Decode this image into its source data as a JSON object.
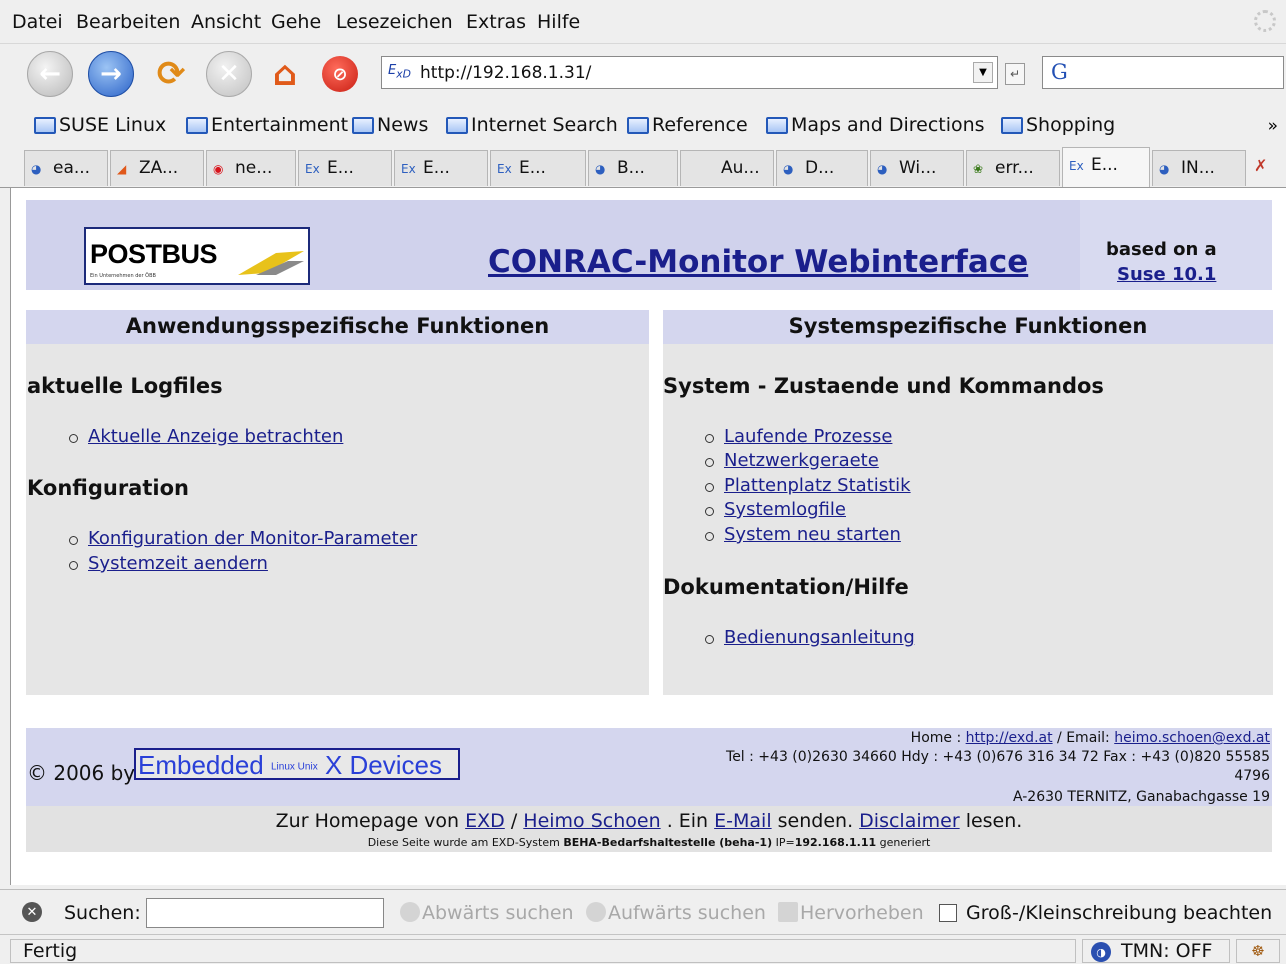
{
  "menu": {
    "items": [
      "Datei",
      "Bearbeiten",
      "Ansicht",
      "Gehe",
      "Lesezeichen",
      "Extras",
      "Hilfe"
    ]
  },
  "navbar": {
    "url": "http://192.168.1.31/",
    "url_favicon": "Exd-icon",
    "search_engine": "G"
  },
  "bookmarks": {
    "items": [
      "SUSE Linux",
      "Entertainment",
      "News",
      "Internet Search",
      "Reference",
      "Maps and Directions",
      "Shopping"
    ],
    "more": "»"
  },
  "tabs": [
    {
      "label": "ea..."
    },
    {
      "label": "ZA..."
    },
    {
      "label": "ne..."
    },
    {
      "label": "E..."
    },
    {
      "label": "E..."
    },
    {
      "label": "E..."
    },
    {
      "label": "B..."
    },
    {
      "label": "Au..."
    },
    {
      "label": "D..."
    },
    {
      "label": "Wi..."
    },
    {
      "label": "err..."
    },
    {
      "label": "E..."
    },
    {
      "label": "IN..."
    }
  ],
  "page": {
    "logo_text": "POSTBUS",
    "logo_sub": "Ein Unternehmen der ÖBB",
    "title": "CONRAC-Monitor Webinterface",
    "based_on": "based on a",
    "suse_link": "Suse 10.1",
    "left": {
      "heading": "Anwendungsspezifische Funktionen",
      "sec1": "aktuelle Logfiles",
      "sec1_items": [
        "Aktuelle Anzeige betrachten"
      ],
      "sec2": "Konfiguration",
      "sec2_items": [
        "Konfiguration der Monitor-Parameter",
        "Systemzeit aendern"
      ]
    },
    "right": {
      "heading": "Systemspezifische Funktionen",
      "sec1": "System - Zustaende und Kommandos",
      "sec1_items": [
        "Laufende Prozesse",
        "Netzwerkgeraete",
        "Plattenplatz Statistik",
        "Systemlogfile",
        "System neu starten"
      ],
      "sec2": "Dokumentation/Hilfe",
      "sec2_items": [
        "Bedienungsanleitung"
      ]
    },
    "footer": {
      "copyright": "© 2006 by",
      "exd_logo_a": "Embedded",
      "exd_logo_mid": "Linux Unix",
      "exd_logo_b": "X Devices",
      "home_label": "Home :",
      "home_link": "http://exd.at",
      "email_label": "/ Email:",
      "email_link": "heimo.schoen@exd.at",
      "tel_line": "Tel : +43 (0)2630 34660 Hdy : +43 (0)676 316 34 72 Fax : +43 (0)820 55585",
      "tel_line2": "4796",
      "address": "A-2630 TERNITZ, Ganabachgasse 19",
      "nav_pre": "Zur Homepage von",
      "nav_exd": "EXD",
      "nav_sep": "/",
      "nav_heimo": "Heimo Schoen",
      "nav_mid": ". Ein",
      "nav_email": "E-Mail",
      "nav_mid2": "senden.",
      "nav_disclaimer": "Disclaimer",
      "nav_end": "lesen.",
      "gen_pre": "Diese Seite wurde am EXD-System",
      "gen_bold1": "BEHA-Bedarfshaltestelle (beha-1)",
      "gen_mid": "IP=",
      "gen_bold2": "192.168.1.11",
      "gen_end": "generiert"
    }
  },
  "findbar": {
    "label": "Suchen:",
    "value": "",
    "down": "Abwärts suchen",
    "up": "Aufwärts suchen",
    "highlight": "Hervorheben",
    "case_label": "Groß-/Kleinschreibung beachten"
  },
  "status": {
    "text": "Fertig",
    "tmn": "TMN: OFF"
  }
}
